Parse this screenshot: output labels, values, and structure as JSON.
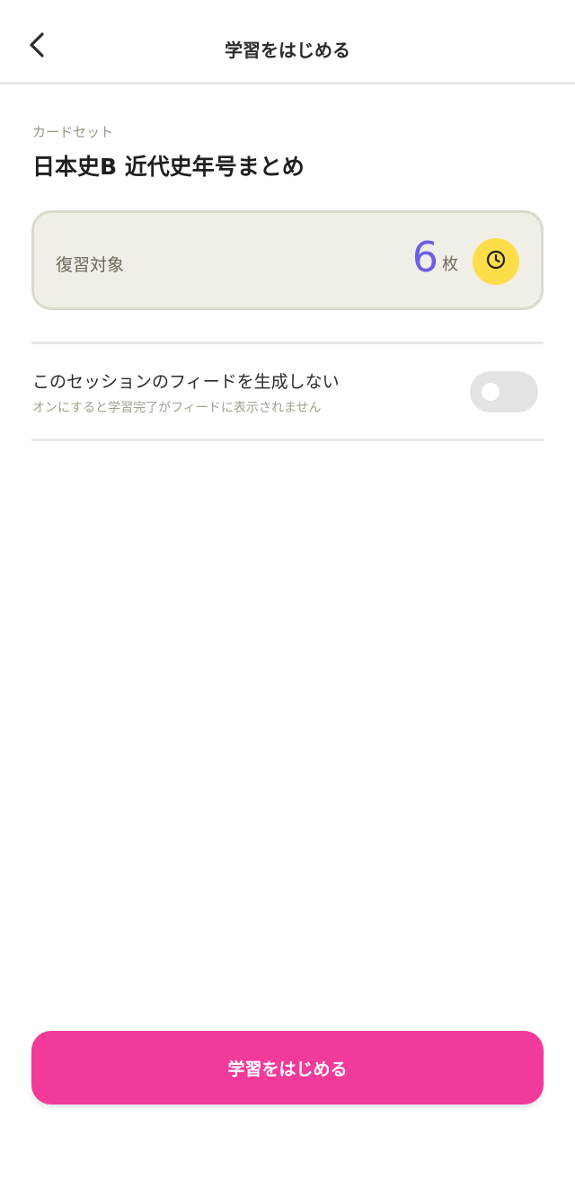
{
  "header": {
    "title": "学習をはじめる",
    "back_icon": "chevron-left-icon"
  },
  "card_set": {
    "label": "カードセット",
    "name": "日本史B 近代史年号まとめ"
  },
  "review": {
    "label": "復習対象",
    "count": "6",
    "unit": "枚",
    "icon": "clock-icon",
    "accent_color": "#6c5de6",
    "icon_bg_color": "#fddd4a"
  },
  "feed_setting": {
    "title": "このセッションのフィードを生成しない",
    "description": "オンにすると学習完了がフィードに表示されません",
    "enabled": false
  },
  "start_button": {
    "label": "学習をはじめる",
    "color": "#f23a9a"
  }
}
